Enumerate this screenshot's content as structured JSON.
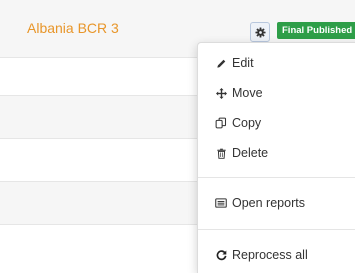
{
  "project": {
    "title": "Albania BCR 3",
    "status_badge": "Final Published",
    "title_color": "#e8962a",
    "badge_color": "#2e9e48"
  },
  "settings_button": {
    "icon": "gear-icon"
  },
  "menu": {
    "items": [
      {
        "label": "Edit",
        "icon": "pencil-icon"
      },
      {
        "label": "Move",
        "icon": "move-arrows-icon"
      },
      {
        "label": "Copy",
        "icon": "copy-icon"
      },
      {
        "label": "Delete",
        "icon": "trash-icon"
      },
      {
        "label": "Open reports",
        "icon": "report-icon"
      },
      {
        "label": "Reprocess all",
        "icon": "refresh-icon"
      }
    ]
  }
}
